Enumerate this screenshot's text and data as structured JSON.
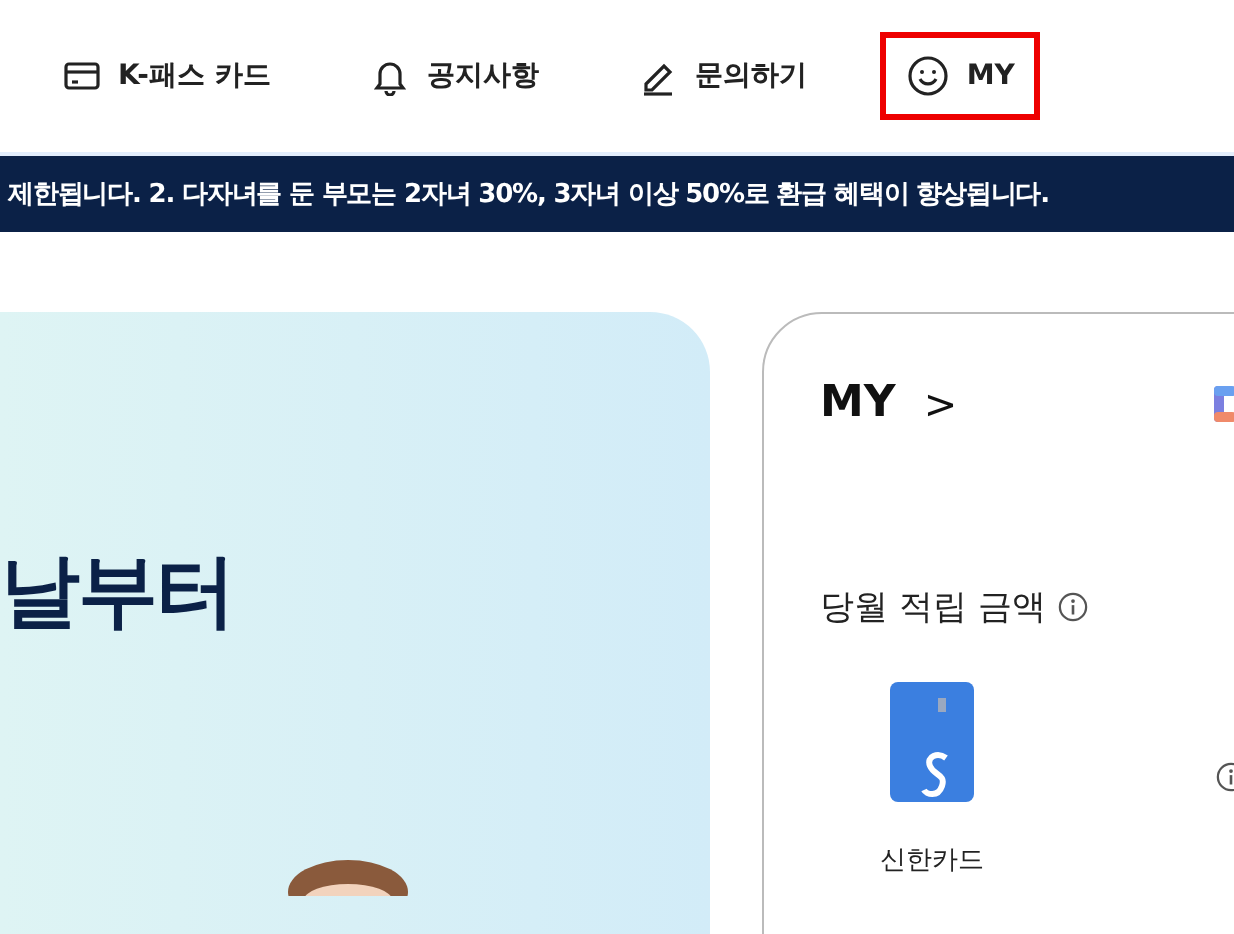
{
  "nav": [
    {
      "kind": "card",
      "label": "K-패스 카드",
      "selected": false
    },
    {
      "kind": "bell",
      "label": "공지사항",
      "selected": false
    },
    {
      "kind": "pencil",
      "label": "문의하기",
      "selected": false
    },
    {
      "kind": "smile",
      "label": "MY",
      "selected": true
    }
  ],
  "notice_banner": {
    "text": "제한됩니다. 2. 다자녀를 둔 부모는 2자녀 30%, 3자녀 이상 50%로 환급 혜택이 향상됩니다."
  },
  "hero": {
    "title": "날부터"
  },
  "my_card": {
    "title": "MY",
    "chevron": ">",
    "section_title": "당월 적립 금액",
    "card_name": "신한카드"
  }
}
